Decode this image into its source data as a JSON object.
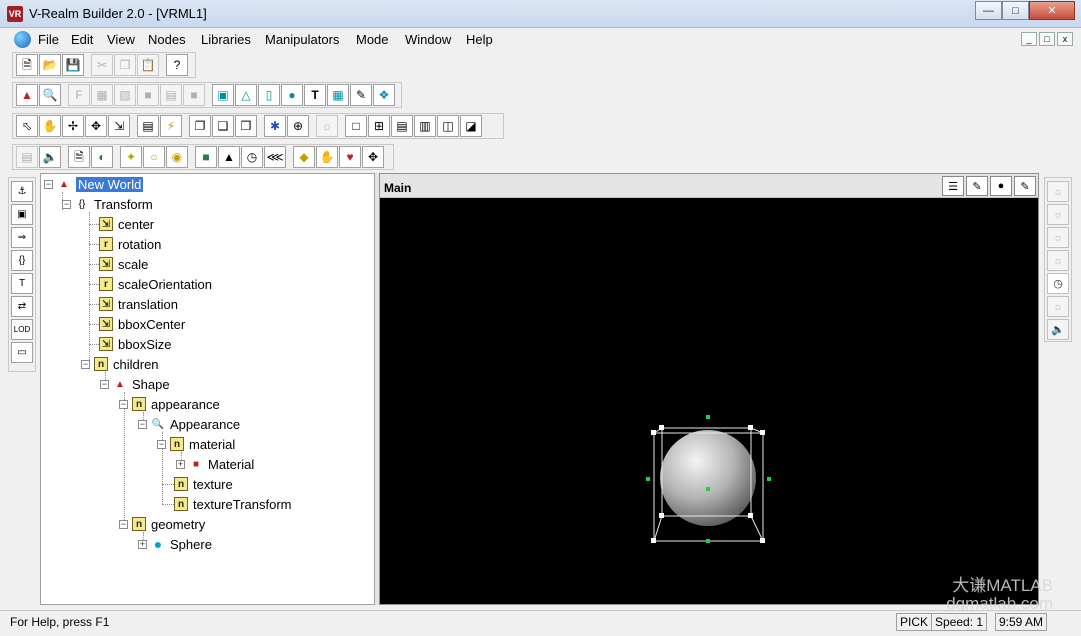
{
  "window": {
    "title": "V-Realm Builder 2.0 - [VRML1]"
  },
  "menu": [
    "File",
    "Edit",
    "View",
    "Nodes",
    "Libraries",
    "Manipulators",
    "Mode",
    "Window",
    "Help"
  ],
  "view": {
    "title": "Main"
  },
  "tree": {
    "root": "New World",
    "transform": "Transform",
    "fields": [
      "center",
      "rotation",
      "scale",
      "scaleOrientation",
      "translation",
      "bboxCenter",
      "bboxSize"
    ],
    "children": "children",
    "shape": "Shape",
    "appearance": "appearance",
    "appearance_node": "Appearance",
    "material": "material",
    "material_node": "Material",
    "texture": "texture",
    "texture_transform": "textureTransform",
    "geometry": "geometry",
    "sphere": "Sphere"
  },
  "status": {
    "help": "For Help, press F1",
    "mode": "PICK",
    "speed": "Speed: 1",
    "time": "9:59 AM"
  },
  "watermark": {
    "line1": "大谦MATLAB",
    "line2": "dqmatlab.com"
  }
}
